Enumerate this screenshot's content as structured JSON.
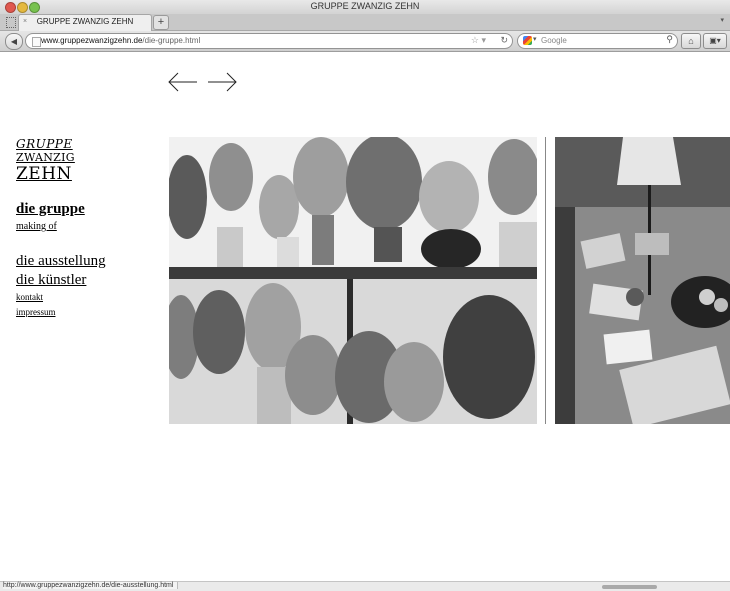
{
  "window": {
    "title": "GRUPPE ZWANZIG ZEHN"
  },
  "tab": {
    "label": "GRUPPE ZWANZIG ZEHN",
    "close": "×",
    "new_tab": "+",
    "menu": "▾"
  },
  "toolbar": {
    "back": "◀",
    "url_host": "www.gruppezwanzigzehn.de",
    "url_path": "/die-gruppe.html",
    "star": "☆ ▾",
    "reload": "↻",
    "search_placeholder": "Google",
    "search_icon": "⚲",
    "home": "⌂",
    "bookmarks": "▣▾"
  },
  "logo": {
    "line1": "GRUPPE",
    "line2": "ZWANZIG",
    "line3": "ZEHN"
  },
  "nav": {
    "die_gruppe": "die gruppe",
    "making_of": "making of",
    "die_ausstellung": "die ausstellung",
    "die_kuenstler": "die künstler",
    "kontakt": "kontakt",
    "impressum": "impressum"
  },
  "gallery": {
    "prev_icon": "arrow-left-icon",
    "next_icon": "arrow-right-icon",
    "photos": [
      "sculpture-heads-photo",
      "studio-table-photo"
    ]
  },
  "status": {
    "text": "http://www.gruppezwanzigzehn.de/die-ausstellung.html"
  }
}
